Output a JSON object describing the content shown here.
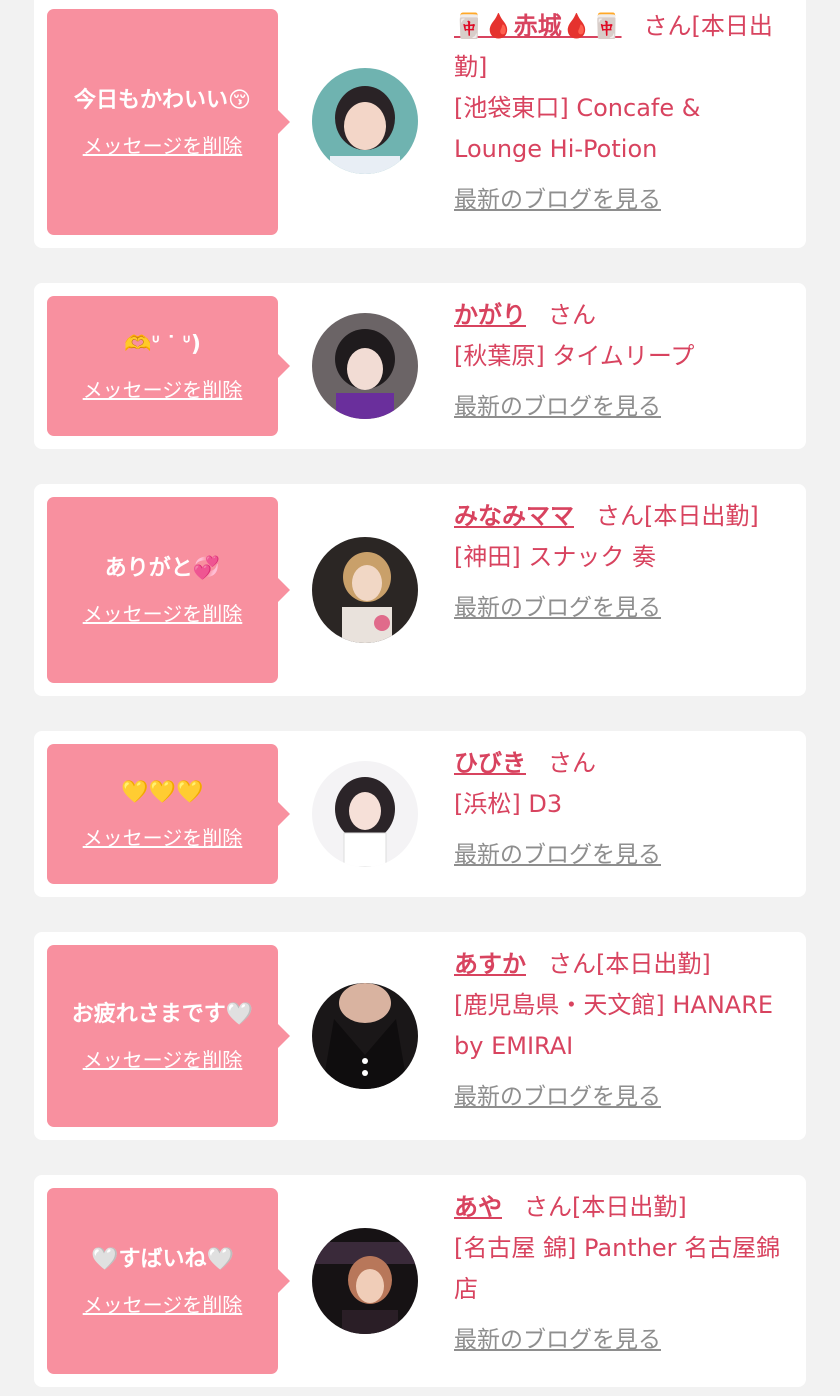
{
  "delete_label": "メッセージを削除",
  "blog_label": "最新のブログを見る",
  "accent_color": "#d8435f",
  "bubble_color": "#f8909f",
  "messages": [
    {
      "message": "今日もかわいい😚",
      "name": "🀄🩸赤城🩸🀄",
      "suffix": "さん[本日出勤]",
      "shop": "[池袋東口] Concafe & Lounge Hi-Potion"
    },
    {
      "message": "🫶ᐡ ᐝ ᐡ)",
      "name": "かがり",
      "suffix": "さん",
      "shop": "[秋葉原] タイムリープ"
    },
    {
      "message": "ありがと💞",
      "name": "みなみママ",
      "suffix": "さん[本日出勤]",
      "shop": "[神田] スナック 奏"
    },
    {
      "message": "💛💛💛",
      "name": "ひびき",
      "suffix": "さん",
      "shop": "[浜松] D3"
    },
    {
      "message": "お疲れさまです🤍",
      "name": "あすか",
      "suffix": "さん[本日出勤]",
      "shop": "[鹿児島県・天文館] HANARE by EMIRAI"
    },
    {
      "message": "🤍すばいね🤍",
      "name": "あや",
      "suffix": "さん[本日出勤]",
      "shop": "[名古屋 錦] Panther 名古屋錦店"
    }
  ]
}
